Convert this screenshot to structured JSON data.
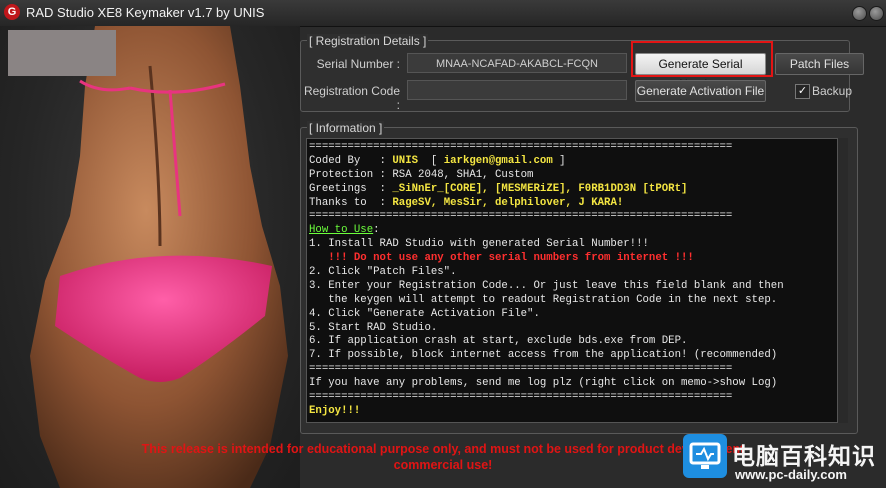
{
  "window": {
    "title": "RAD Studio XE8 Keymaker v1.7 by UNIS",
    "app_icon_glyph": "G"
  },
  "registration": {
    "caption": "[ Registration Details ]",
    "serial_label": "Serial Number :",
    "serial_value": "MNAA-NCAFAD-AKABCL-FCQN",
    "regcode_label": "Registration Code :",
    "regcode_value": "",
    "generate_serial_button": "Generate Serial Number",
    "patch_files_button": "Patch Files",
    "generate_activation_button": "Generate Activation File",
    "backup_label": "Backup",
    "backup_checked": true
  },
  "information": {
    "caption": "[ Information ]",
    "lines": [
      [
        {
          "t": "==================================================================",
          "c": "c"
        }
      ],
      [
        {
          "t": "Coded By   : ",
          "c": "c"
        },
        {
          "t": "UNIS",
          "c": "y"
        },
        {
          "t": "  [ ",
          "c": "c"
        },
        {
          "t": "iarkgen@gmail.com",
          "c": "y"
        },
        {
          "t": " ]",
          "c": "c"
        }
      ],
      [
        {
          "t": "Protection : RSA 2048, SHA1, Custom",
          "c": "c"
        }
      ],
      [
        {
          "t": "Greetings  : ",
          "c": "c"
        },
        {
          "t": "_SiNnEr_[CORE], [MESMERiZE], F0RB1DD3N [tPORt]",
          "c": "y"
        }
      ],
      [
        {
          "t": "Thanks to  : ",
          "c": "c"
        },
        {
          "t": "RageSV, MesSir, delphilover, J KARA!",
          "c": "y"
        }
      ],
      [
        {
          "t": "==================================================================",
          "c": "c"
        }
      ],
      [
        {
          "t": "How to Use",
          "c": "g"
        },
        {
          "t": ":",
          "c": "c"
        }
      ],
      [
        {
          "t": "1. Install RAD Studio with generated Serial Number!!!",
          "c": "c"
        }
      ],
      [
        {
          "t": "   !!! Do not use any other serial numbers from internet !!!",
          "c": "r"
        }
      ],
      [
        {
          "t": "2. Click \"Patch Files\".",
          "c": "c"
        }
      ],
      [
        {
          "t": "3. Enter your Registration Code... Or just leave this field blank and then",
          "c": "c"
        }
      ],
      [
        {
          "t": "   the keygen will attempt to readout Registration Code in the next step.",
          "c": "c"
        }
      ],
      [
        {
          "t": "4. Click \"Generate Activation File\".",
          "c": "c"
        }
      ],
      [
        {
          "t": "5. Start RAD Studio.",
          "c": "c"
        }
      ],
      [
        {
          "t": "6. If application crash at start, exclude bds.exe from DEP.",
          "c": "c"
        }
      ],
      [
        {
          "t": "7. If possible, block internet access from the application! (recommended)",
          "c": "c"
        }
      ],
      [
        {
          "t": "==================================================================",
          "c": "c"
        }
      ],
      [
        {
          "t": "If you have any problems, send me log plz (right click on memo->show Log)",
          "c": "c"
        }
      ],
      [
        {
          "t": "==================================================================",
          "c": "c"
        }
      ],
      [
        {
          "t": "Enjoy!!!",
          "c": "y"
        }
      ]
    ]
  },
  "footer": {
    "line1": "This release is intended for educational purpose only, and must not be used for product development",
    "line2": "commercial use!"
  },
  "watermark": {
    "text": "电脑百科知识",
    "url": "www.pc-daily.com"
  },
  "colors": {
    "accent_red": "#e21414",
    "memo_yellow": "#f4e642",
    "memo_green": "#6cff3c",
    "watermark_blue": "#1e8ee0"
  }
}
